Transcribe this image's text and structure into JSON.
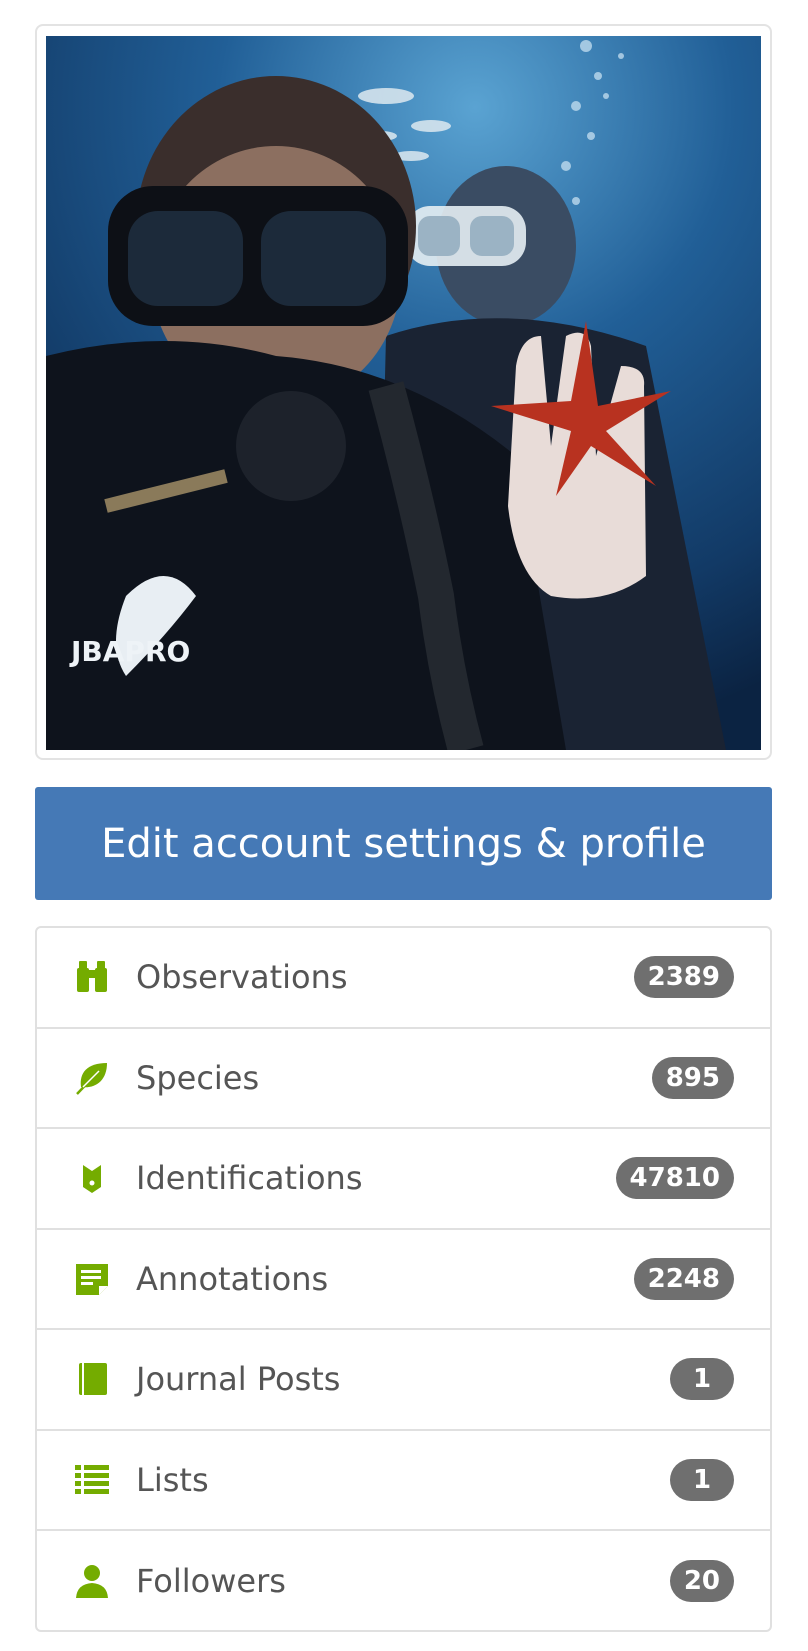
{
  "profile_photo": {
    "logo_text": "JBAPRO"
  },
  "edit_button": {
    "label": "Edit account settings & profile"
  },
  "accent_color": "#74ac00",
  "button_color": "#4579b6",
  "stats": [
    {
      "label": "Observations",
      "count": "2389",
      "icon": "binoculars-icon"
    },
    {
      "label": "Species",
      "count": "895",
      "icon": "leaf-icon"
    },
    {
      "label": "Identifications",
      "count": "47810",
      "icon": "identification-icon"
    },
    {
      "label": "Annotations",
      "count": "2248",
      "icon": "annotation-icon"
    },
    {
      "label": "Journal Posts",
      "count": "1",
      "icon": "book-icon"
    },
    {
      "label": "Lists",
      "count": "1",
      "icon": "list-icon"
    },
    {
      "label": "Followers",
      "count": "20",
      "icon": "person-icon"
    }
  ]
}
